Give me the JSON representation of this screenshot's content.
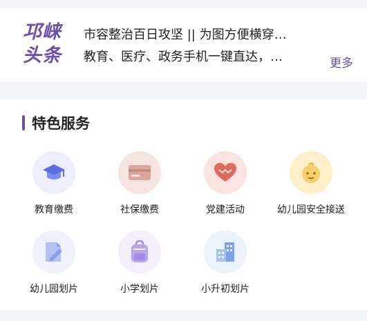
{
  "news": {
    "logo_line1": "邛崃",
    "logo_line2": "头条",
    "headlines": [
      "市容整治百日攻坚 || 为图方便横穿…",
      "教育、医疗、政务手机一键直达，…"
    ],
    "more_label": "更多"
  },
  "services": {
    "title": "特色服务",
    "items": [
      {
        "label": "教育缴费",
        "icon": "graduation-cap-icon",
        "color": "#5b6ee1",
        "bg": "#eceefe"
      },
      {
        "label": "社保缴费",
        "icon": "card-icon",
        "color": "#c98a7e",
        "bg": "#f5e3df"
      },
      {
        "label": "党建活动",
        "icon": "heart-icon",
        "color": "#d9534a",
        "bg": "#fbe3df"
      },
      {
        "label": "幼儿园安全接送",
        "icon": "baby-face-icon",
        "color": "#f2c24f",
        "bg": "#fdefc8"
      },
      {
        "label": "幼儿园划片",
        "icon": "map-pencil-icon",
        "color": "#8f9fe6",
        "bg": "#eef1fc"
      },
      {
        "label": "小学划片",
        "icon": "school-bag-icon",
        "color": "#a28be0",
        "bg": "#f4eefc"
      },
      {
        "label": "小升初划片",
        "icon": "buildings-icon",
        "color": "#7fa3e6",
        "bg": "#eaf2fc"
      }
    ]
  }
}
